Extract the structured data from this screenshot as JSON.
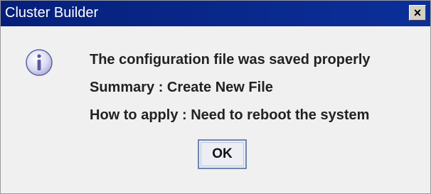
{
  "window": {
    "title": "Cluster Builder",
    "close_label": "×"
  },
  "dialog": {
    "icon": "info-icon",
    "message": "The configuration file was saved properly",
    "summary": "Summary : Create New File",
    "how_to_apply": "How to apply : Need to reboot the system",
    "ok_label": "OK"
  },
  "colors": {
    "titlebar": "#0b2f9a",
    "title_text": "#ffffff",
    "background": "#f0f0f0",
    "ok_border": "#6f86b0"
  }
}
